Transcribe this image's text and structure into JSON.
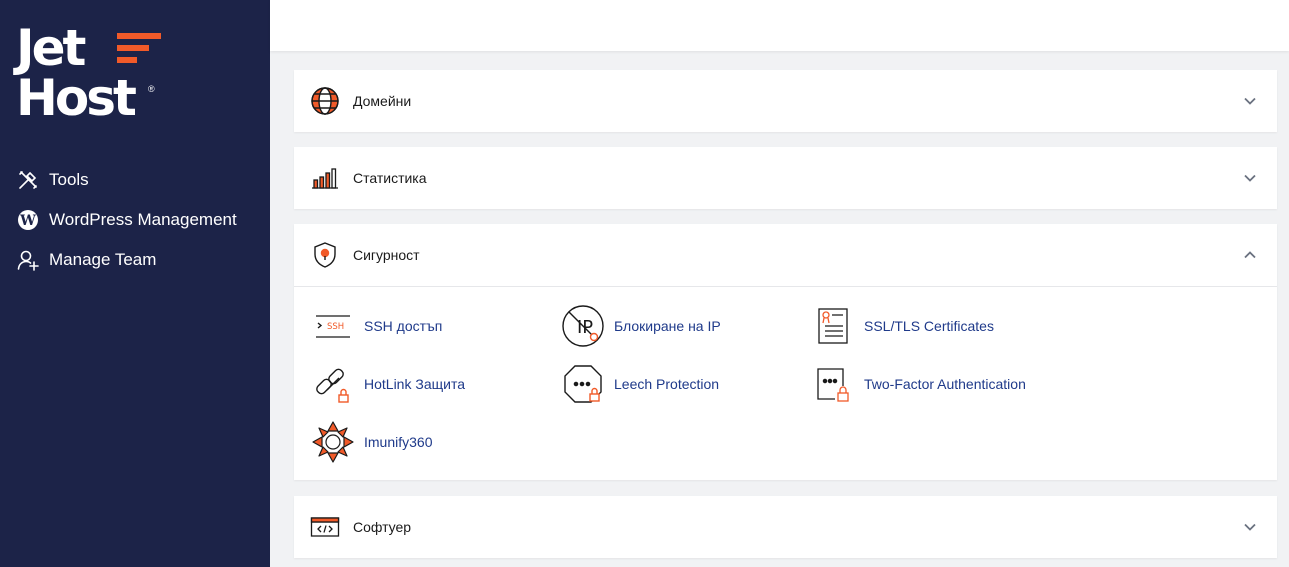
{
  "brand": {
    "line1": "Jet",
    "line2": "Host",
    "reg": "®",
    "accent": "#f15a29",
    "sidebar_bg": "#1c2348"
  },
  "sidebar": {
    "items": [
      {
        "label": "Tools",
        "icon": "tools-icon"
      },
      {
        "label": "WordPress Management",
        "icon": "wordpress-icon"
      },
      {
        "label": "Manage Team",
        "icon": "user-add-icon"
      }
    ]
  },
  "panels": {
    "domains": {
      "title": "Домейни",
      "icon": "globe-icon",
      "state": "collapsed"
    },
    "stats": {
      "title": "Статистика",
      "icon": "bar-chart-icon",
      "state": "collapsed"
    },
    "security": {
      "title": "Сигурност",
      "icon": "shield-icon",
      "state": "expanded",
      "tools": [
        {
          "label": "SSH достъп",
          "icon": "ssh-terminal-icon"
        },
        {
          "label": "Блокиране на IP",
          "icon": "ip-block-icon"
        },
        {
          "label": "SSL/TLS Certificates",
          "icon": "certificate-icon"
        },
        {
          "label": "HotLink Защита",
          "icon": "hotlink-chain-icon"
        },
        {
          "label": "Leech Protection",
          "icon": "leech-protection-icon"
        },
        {
          "label": "Two-Factor Authentication",
          "icon": "two-factor-icon"
        },
        {
          "label": "Imunify360",
          "icon": "imunify360-icon"
        }
      ]
    },
    "software": {
      "title": "Софтуер",
      "icon": "code-window-icon",
      "state": "collapsed"
    }
  }
}
